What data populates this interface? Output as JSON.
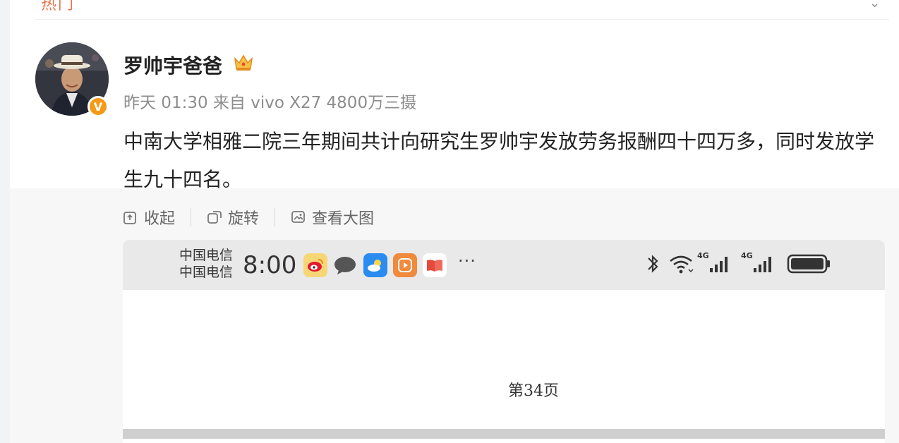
{
  "header": {
    "partial_tab_label": "热门"
  },
  "post": {
    "username": "罗帅宇爸爸",
    "meta": "昨天 01:30 来自 vivo X27 4800万三摄",
    "text": "中南大学相雅二院三年期间共计向研究生罗帅宇发放劳务报酬四十四万多，同时发放学生九十四名。"
  },
  "media_actions": {
    "collapse_label": "收起",
    "rotate_label": "旋转",
    "view_large_label": "查看大图"
  },
  "screenshot": {
    "carrier_line1": "中国电信",
    "carrier_line2": "中国电信",
    "time": "8:00",
    "signal_label_1": "4G",
    "signal_label_2": "4G",
    "page_number": "第34页"
  }
}
